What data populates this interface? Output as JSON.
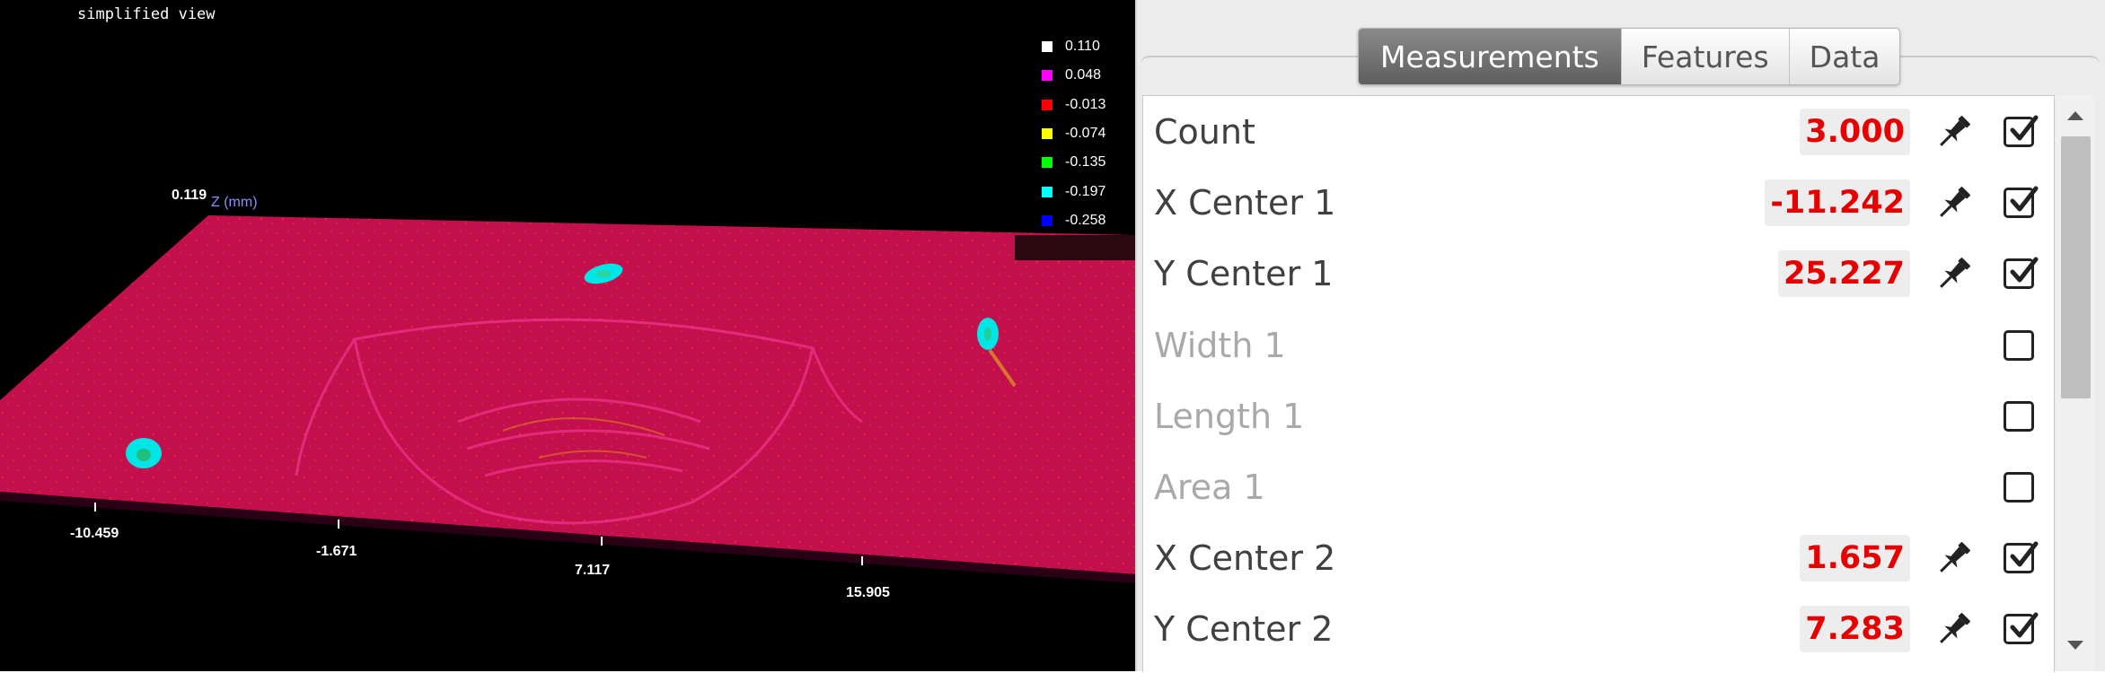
{
  "viewer": {
    "view_mode": "simplified view",
    "legend": [
      {
        "label": "0.110",
        "color": "#ffffff"
      },
      {
        "label": "0.048",
        "color": "#ff00ff"
      },
      {
        "label": "-0.013",
        "color": "#ff0000"
      },
      {
        "label": "-0.074",
        "color": "#ffff00"
      },
      {
        "label": "-0.135",
        "color": "#00ff00"
      },
      {
        "label": "-0.197",
        "color": "#00ffff"
      },
      {
        "label": "-0.258",
        "color": "#0000ff"
      }
    ],
    "z_top_value": "0.119",
    "z_axis_label": "Z (mm)",
    "x_ticks": [
      "-10.459",
      "-1.671",
      "7.117",
      "15.905"
    ],
    "surface_color": "#c3104d"
  },
  "panel": {
    "tabs": [
      {
        "label": "Measurements",
        "active": true
      },
      {
        "label": "Features",
        "active": false
      },
      {
        "label": "Data",
        "active": false
      }
    ],
    "measurements": [
      {
        "label": "Count",
        "value": "3.000",
        "pinned": true,
        "checked": true,
        "enabled": true
      },
      {
        "label": "X Center 1",
        "value": "-11.242",
        "pinned": true,
        "checked": true,
        "enabled": true
      },
      {
        "label": "Y Center 1",
        "value": "25.227",
        "pinned": true,
        "checked": true,
        "enabled": true
      },
      {
        "label": "Width 1",
        "value": "",
        "pinned": false,
        "checked": false,
        "enabled": false
      },
      {
        "label": "Length 1",
        "value": "",
        "pinned": false,
        "checked": false,
        "enabled": false
      },
      {
        "label": "Area 1",
        "value": "",
        "pinned": false,
        "checked": false,
        "enabled": false
      },
      {
        "label": "X Center 2",
        "value": "1.657",
        "pinned": true,
        "checked": true,
        "enabled": true
      },
      {
        "label": "Y Center 2",
        "value": "7.283",
        "pinned": true,
        "checked": true,
        "enabled": true
      }
    ],
    "accent_color": "#e60000"
  }
}
